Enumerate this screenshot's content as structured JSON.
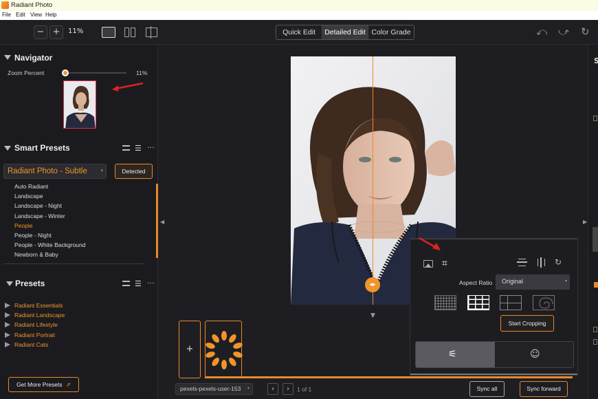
{
  "window": {
    "title": "Radiant Photo"
  },
  "menu": [
    "File",
    "Edit",
    "View",
    "Help"
  ],
  "toolbar": {
    "zoom_out": "−",
    "zoom_in": "+",
    "zoom": "11%",
    "tabs": [
      "Quick Edit",
      "Detailed Edit",
      "Color Grade"
    ],
    "active_tab": "Detailed Edit"
  },
  "navigator": {
    "title": "Navigator",
    "zoom_label": "Zoom Percent",
    "zoom_value": "11%",
    "zoom_fraction": 0.11
  },
  "smart_presets": {
    "title": "Smart Presets",
    "selected": "Radiant Photo - Subtle",
    "detected_button": "Detected",
    "items": [
      "Auto Radiant",
      "Landscape",
      "Landscape - Night",
      "Landscape - Winter",
      "People",
      "People - Night",
      "People - White Background",
      "Newborn & Baby"
    ],
    "active_item": "People"
  },
  "presets": {
    "title": "Presets",
    "items": [
      "Radiant Essentials",
      "Radiant Landscape",
      "Radiant Lifestyle",
      "Radiant Portrait",
      "Radiant Cats"
    ]
  },
  "get_more": "Get More Presets",
  "crop_panel": {
    "aspect_label": "Aspect Ratio",
    "aspect_value": "Original",
    "start_button": "Start Cropping"
  },
  "filmstrip": {
    "add": "+"
  },
  "bottom": {
    "filename": "pexels-pexels-user-153",
    "page_info": "1 of 1",
    "sync_all": "Sync all",
    "sync_forward": "Sync forward"
  },
  "colors": {
    "accent": "#f0942b",
    "bg": "#1e1e22",
    "annotation": "#e02020"
  }
}
